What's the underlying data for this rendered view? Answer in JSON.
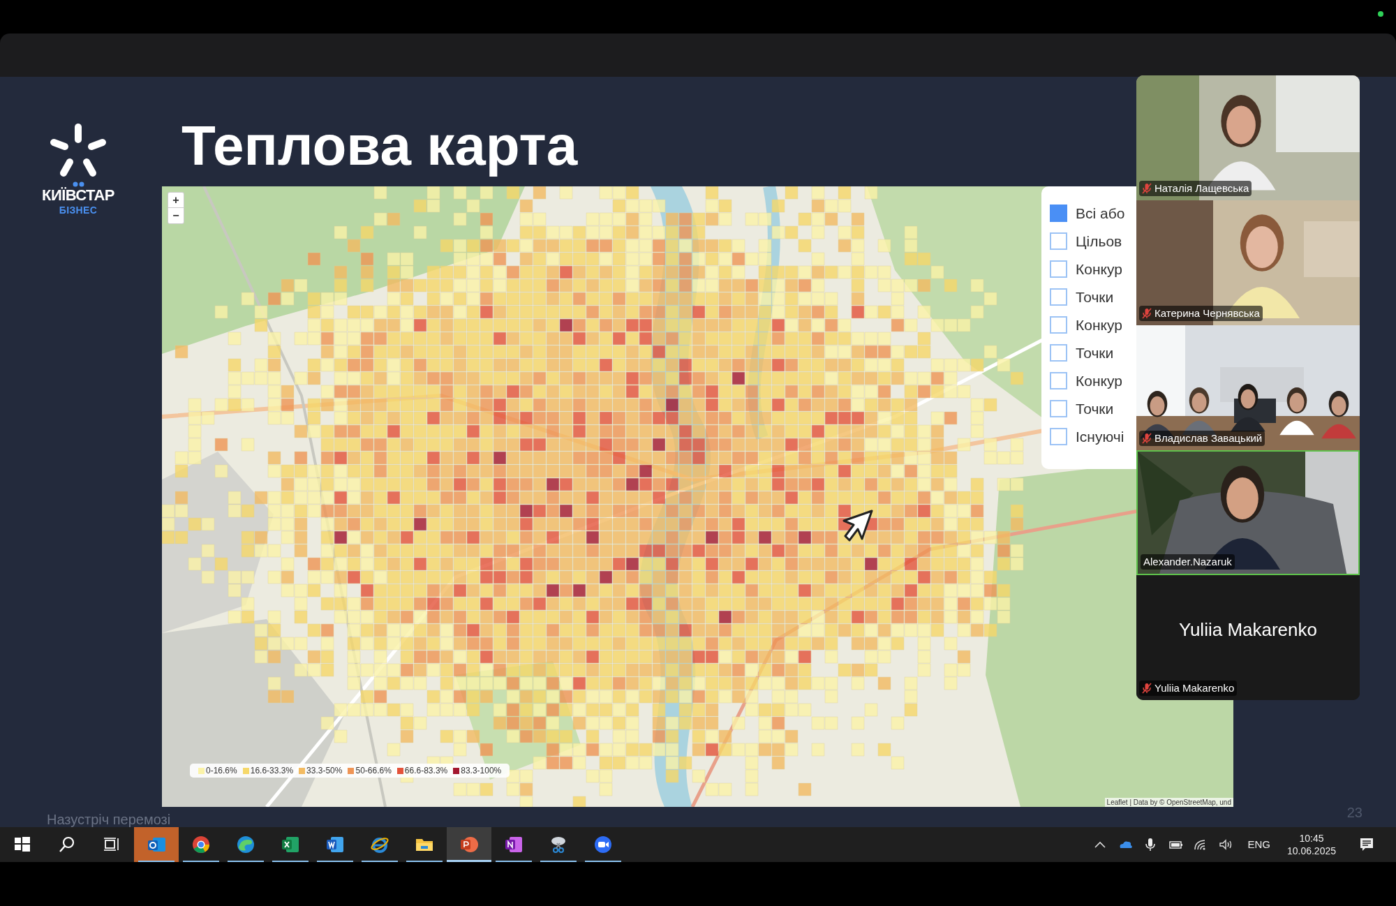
{
  "slide": {
    "logo": {
      "brand": "КИЇВСТАР",
      "tagline": "БІЗНЕС"
    },
    "title": "Теплова карта",
    "map": {
      "zoom_controls": [
        "+",
        "−"
      ],
      "layers": [
        {
          "label": "Всі або",
          "checked": true
        },
        {
          "label": "Цільов",
          "checked": false
        },
        {
          "label": "Конкур",
          "checked": false
        },
        {
          "label": "Точки",
          "checked": false
        },
        {
          "label": "Конкур",
          "checked": false
        },
        {
          "label": "Точки",
          "checked": false
        },
        {
          "label": "Конкур",
          "checked": false
        },
        {
          "label": "Точки",
          "checked": false
        },
        {
          "label": "Існуючі",
          "checked": false
        }
      ],
      "legend": [
        {
          "label": "0-16.6%",
          "color": "#fbf3a8"
        },
        {
          "label": "16.6-33.3%",
          "color": "#f6d86a"
        },
        {
          "label": "33.3-50%",
          "color": "#f3bb62"
        },
        {
          "label": "50-66.6%",
          "color": "#ef9555"
        },
        {
          "label": "66.6-83.3%",
          "color": "#e4533a"
        },
        {
          "label": "83.3-100%",
          "color": "#a3172e"
        }
      ],
      "attribution": "Leaflet | Data by © OpenStreetMap, und"
    },
    "footer": "Назустріч перемозі",
    "page_number": "23"
  },
  "participants": [
    {
      "kind": "room",
      "name": "Наталія Лащевська",
      "muted": true,
      "speaking": false
    },
    {
      "kind": "room",
      "name": "Катерина Чернявська",
      "muted": true,
      "speaking": false
    },
    {
      "kind": "classroom",
      "name": "Владислав Завацький",
      "muted": true,
      "speaking": false
    },
    {
      "kind": "plant",
      "name": "Alexander.Nazaruk",
      "muted": false,
      "speaking": true
    },
    {
      "kind": "avatar",
      "display_name": "Yuliia Makarenko",
      "name": "Yuliia Makarenko",
      "muted": true,
      "speaking": false
    }
  ],
  "taskbar": {
    "buttons": [
      {
        "kind": "start"
      },
      {
        "kind": "search"
      },
      {
        "kind": "task-view"
      }
    ],
    "apps": [
      {
        "kind": "outlook",
        "flashing": true,
        "selected": false,
        "running": true
      },
      {
        "kind": "chrome",
        "flashing": false,
        "selected": false,
        "running": true
      },
      {
        "kind": "edge",
        "flashing": false,
        "selected": false,
        "running": true
      },
      {
        "kind": "excel",
        "flashing": false,
        "selected": false,
        "running": true
      },
      {
        "kind": "word",
        "flashing": false,
        "selected": false,
        "running": true
      },
      {
        "kind": "ie",
        "flashing": false,
        "selected": false,
        "running": true
      },
      {
        "kind": "explorer",
        "flashing": false,
        "selected": false,
        "running": true
      },
      {
        "kind": "powerpoint",
        "flashing": false,
        "selected": true,
        "running": true
      },
      {
        "kind": "onenote",
        "flashing": false,
        "selected": false,
        "running": true
      },
      {
        "kind": "snipping",
        "flashing": false,
        "selected": false,
        "running": true
      },
      {
        "kind": "zoom",
        "flashing": false,
        "selected": false,
        "running": true
      }
    ],
    "tray": {
      "language": "ENG",
      "time": "10:45",
      "date": "10.06.2025"
    }
  }
}
